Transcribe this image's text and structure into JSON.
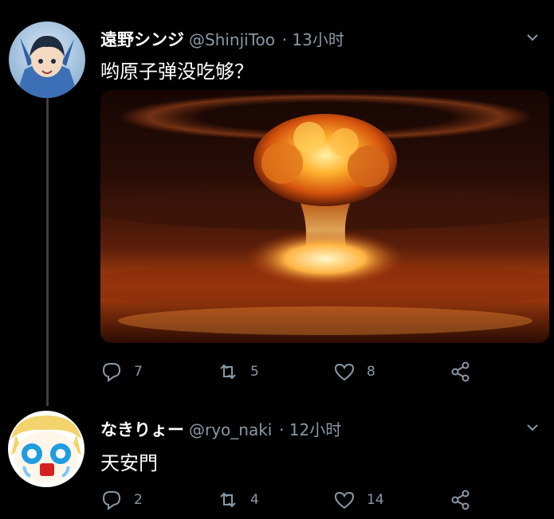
{
  "tweets": [
    {
      "display_name": "遠野シンジ",
      "handle": "@ShinjiToo",
      "time": "· 13小时",
      "text": "哟原子弹没吃够？",
      "replies": "7",
      "retweets": "5",
      "likes": "8"
    },
    {
      "display_name": "なきりょー",
      "handle": "@ryo_naki",
      "time": "· 12小时",
      "text": "天安門",
      "replies": "2",
      "retweets": "4",
      "likes": "14"
    }
  ],
  "icons": [
    "reply-icon",
    "retweet-icon",
    "like-icon",
    "share-icon",
    "chevron-down-icon"
  ],
  "colors": {
    "background": "#000000",
    "muted": "#8899a6",
    "thread_line": "#3a3f44"
  }
}
